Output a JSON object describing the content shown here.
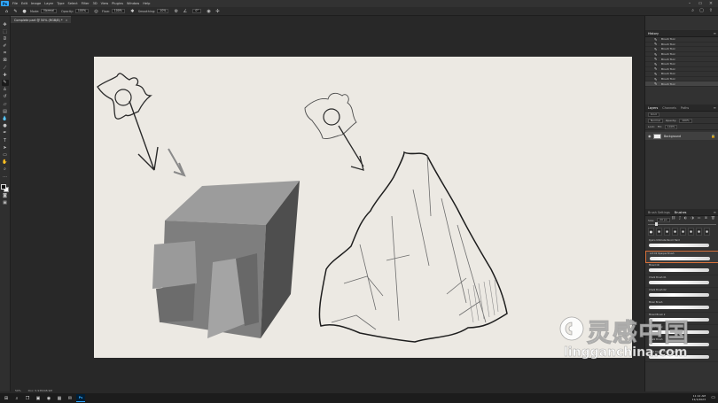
{
  "menubar": {
    "logo": "Ps",
    "items": [
      "File",
      "Edit",
      "Image",
      "Layer",
      "Type",
      "Select",
      "Filter",
      "3D",
      "View",
      "Plugins",
      "Window",
      "Help"
    ]
  },
  "options": {
    "mode_label": "Mode:",
    "mode_value": "Normal",
    "opacity_label": "Opacity:",
    "opacity_value": "100%",
    "flow_label": "Flow:",
    "flow_value": "100%",
    "smoothing_label": "Smoothing:",
    "smoothing_value": "10%",
    "angle_value": "0°"
  },
  "document": {
    "tab_title": "Complete part @ 50% (RGB/8) *",
    "close": "×"
  },
  "status": {
    "zoom": "50%",
    "doc_info": "Doc: 5.93M/48.9M"
  },
  "panels": {
    "history": {
      "title": "History",
      "rows": [
        "Brush Tool",
        "Brush Tool",
        "Brush Tool",
        "Brush Tool",
        "Brush Tool",
        "Brush Tool",
        "Brush Tool",
        "Brush Tool",
        "Brush Tool",
        "Brush Tool"
      ]
    },
    "layers": {
      "tabs": [
        "Layers",
        "Channels",
        "Paths"
      ],
      "layer_name": "Background",
      "kind": "Kind",
      "blend": "Normal",
      "opacity_label": "Opacity:",
      "opacity_value": "100%",
      "lock_label": "Lock:",
      "fill_label": "Fill:",
      "fill_value": "100%"
    },
    "brushes": {
      "tabs": [
        "Brush Settings",
        "Brushes"
      ],
      "size_label": "Size:",
      "size_value": "20 px",
      "items": [
        {
          "name": "Kyle's Ultimate Pencil Hard",
          "selected": false
        },
        {
          "name": "Art Oil Opaque Brush",
          "selected": true
        },
        {
          "name": "Mixed Oil",
          "selected": false
        },
        {
          "name": "Chalk Brush 01",
          "selected": false
        },
        {
          "name": "Chalk Brush 02",
          "selected": false
        },
        {
          "name": "Mixer Brush",
          "selected": false
        },
        {
          "name": "Mixed Brush 2",
          "selected": false
        },
        {
          "name": "Dead Pastel",
          "selected": false
        },
        {
          "name": "Chalk Brush",
          "selected": false
        },
        {
          "name": "Hard Round Pressure Size",
          "selected": false
        }
      ]
    }
  },
  "taskbar": {
    "time": "11:12 AM",
    "date": "11/1/2023"
  },
  "watermark": {
    "cn": "灵感中国",
    "en": "lingganchina.com"
  },
  "colors": {
    "canvas": "#ece9e3",
    "selection": "#d9723b",
    "accent": "#31a8ff"
  }
}
